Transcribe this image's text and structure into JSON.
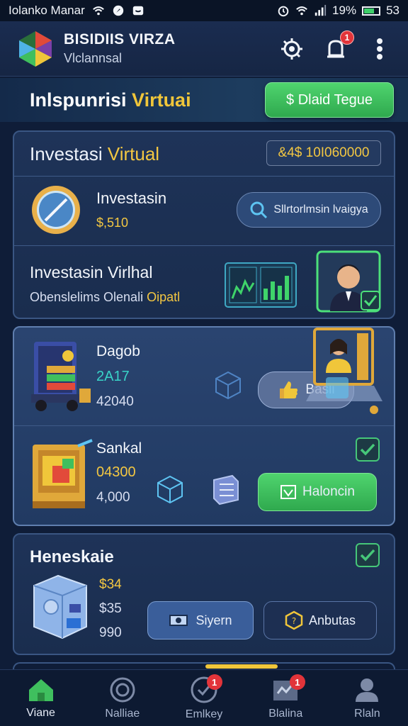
{
  "status_bar": {
    "carrier": "Iolanko Manar",
    "battery_text": "19%",
    "time": "53"
  },
  "header": {
    "title": "BISIDIIS VIRZA",
    "subtitle": "Vlclannsal",
    "notification_count": "1"
  },
  "banner": {
    "title_part1": "Inlspunrisi",
    "title_part2": "Virtuai",
    "button_label": "$ Dlaid Tegue"
  },
  "card1": {
    "title_part1": "Investasi",
    "title_part2": "Virtual",
    "balance": "&4$ 10I060000",
    "row1": {
      "name": "Investasin",
      "value": "$,510",
      "button_label": "Sllrtorlmsin lvaigya"
    },
    "row2": {
      "name": "Investasin Virlhal",
      "desc_part1": "Obenslelims Olenali",
      "desc_part2": "Oipatl"
    }
  },
  "card2": {
    "row1": {
      "name": "Dagob",
      "value1": "2A17",
      "value2": "42040",
      "button_label": "Basli"
    },
    "row2": {
      "name": "Sankal",
      "value1": "04300",
      "value2": "4,000",
      "button_label": "Haloncin"
    }
  },
  "card3": {
    "title": "Heneskaie",
    "value1": "$34",
    "value2": "$35",
    "value3": "990",
    "button1_label": "Siyern",
    "button2_label": "Anbutas"
  },
  "bottom_nav": {
    "items": [
      {
        "label": "Viane",
        "icon": "home-icon",
        "badge": ""
      },
      {
        "label": "Nalliae",
        "icon": "target-icon",
        "badge": ""
      },
      {
        "label": "Emlkey",
        "icon": "gauge-icon",
        "badge": "1"
      },
      {
        "label": "Blalina",
        "icon": "chart-icon",
        "badge": "1"
      },
      {
        "label": "Rlaln",
        "icon": "profile-icon",
        "badge": ""
      }
    ]
  },
  "colors": {
    "accent_gold": "#f0c63a",
    "accent_green": "#3fbf5e",
    "badge_red": "#e2343a",
    "background": "#0f1d38"
  }
}
